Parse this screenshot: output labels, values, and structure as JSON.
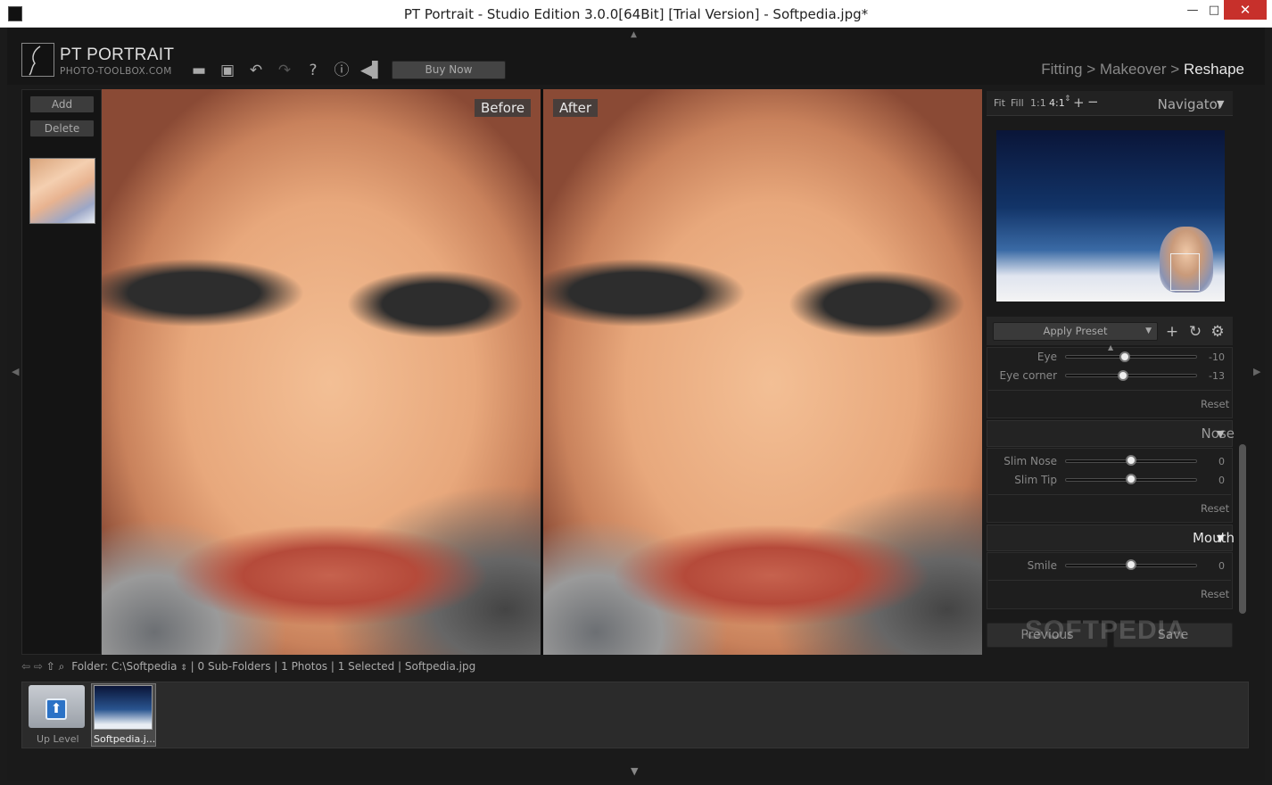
{
  "window": {
    "title": "PT Portrait - Studio Edition 3.0.0[64Bit] [Trial Version] - Softpedia.jpg*",
    "minimize": "—",
    "maximize": "□",
    "close": "✕"
  },
  "app": {
    "logo_title": "PT PORTRAIT",
    "logo_sub": "PHOTO-TOOLBOX.COM",
    "buy_now": "Buy Now"
  },
  "toolbar": {
    "icons": [
      "folder-open-icon",
      "save-icon",
      "undo-icon",
      "redo-icon",
      "help-icon",
      "info-icon",
      "compare-icon"
    ]
  },
  "breadcrumb": {
    "step1": "Fitting",
    "sep": ">",
    "step2": "Makeover",
    "step3": "Reshape"
  },
  "left": {
    "add": "Add",
    "delete": "Delete"
  },
  "view": {
    "before": "Before",
    "after": "After"
  },
  "navigator": {
    "fit": "Fit",
    "fill": "Fill",
    "one_to_one": "1:1",
    "zoom": "4:1",
    "title": "Navigator"
  },
  "preset": {
    "label": "Apply Preset"
  },
  "eye": {
    "items": [
      {
        "label": "Eye",
        "value": "-10"
      },
      {
        "label": "Eye corner",
        "value": "-13"
      }
    ],
    "reset": "Reset"
  },
  "nose": {
    "title": "Nose",
    "items": [
      {
        "label": "Slim Nose",
        "value": "0"
      },
      {
        "label": "Slim Tip",
        "value": "0"
      }
    ],
    "reset": "Reset"
  },
  "mouth": {
    "title": "Mouth",
    "items": [
      {
        "label": "Smile",
        "value": "0"
      }
    ],
    "reset": "Reset"
  },
  "nav_buttons": {
    "previous": "Previous",
    "save": "Save"
  },
  "watermark": "SOFTPEDIA",
  "pathbar": {
    "folder_label": "Folder:",
    "path": "C:\\Softpedia",
    "info": "| 0 Sub-Folders | 1 Photos | 1 Selected | Softpedia.jpg"
  },
  "film": {
    "up_level": "Up Level",
    "file": "Softpedia.j..."
  }
}
